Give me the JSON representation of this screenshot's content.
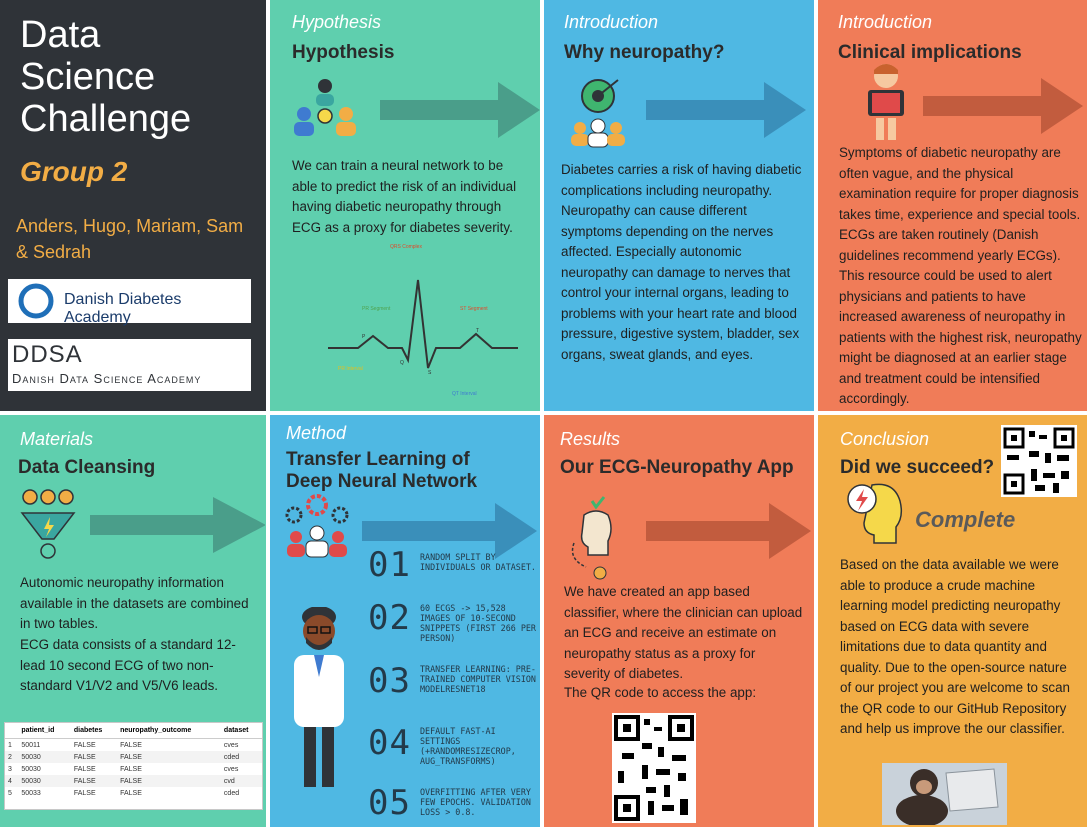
{
  "title_panel": {
    "title_lines": [
      "Data",
      "Science",
      "Challenge"
    ],
    "group": "Group 2",
    "members": "Anders, Hugo, Mariam, Sam & Sedrah",
    "logo1_text": "Danish Diabetes Academy",
    "logo2_abbr": "DDSA",
    "logo2_text": "Danish Data Science Academy"
  },
  "hypothesis": {
    "category": "Hypothesis",
    "heading": "Hypothesis",
    "body": "We can train a neural network to be able to predict the risk of an individual having diabetic neuropathy through ECG as a proxy for diabetes severity.",
    "ecg_labels": {
      "qrs": "QRS Complex",
      "pr": "PR Segment",
      "st": "ST Segment",
      "p": "P",
      "t": "T",
      "q": "Q",
      "s": "S",
      "pr_int": "PR Interval",
      "qt": "QT Interval"
    }
  },
  "intro1": {
    "category": "Introduction",
    "heading": "Why neuropathy?",
    "body": "Diabetes carries a risk of having diabetic complications including neuropathy. Neuropathy can cause different symptoms depending on the nerves affected. Especially autonomic neuropathy can damage to nerves that control your internal organs, leading to problems with your heart rate and blood pressure, digestive system, bladder, sex organs, sweat glands, and eyes."
  },
  "intro2": {
    "category": "Introduction",
    "heading": "Clinical implications",
    "body": "Symptoms of diabetic neuropathy are often vague, and the physical examination require for proper diagnosis takes time, experience and special tools. ECGs are taken routinely (Danish guidelines recommend yearly ECGs). This resource could be used to alert physicians and patients to have increased awareness of neuropathy in patients with the highest risk, neuropathy might be diagnosed at an earlier stage and treatment could be intensified accordingly."
  },
  "materials": {
    "category": "Materials",
    "heading": "Data Cleansing",
    "body1": "Autonomic neuropathy information available in the datasets are combined in two tables.",
    "body2": "ECG data consists of a standard 12-lead 10 second ECG of two non-standard V1/V2 and V5/V6 leads.",
    "table": {
      "columns": [
        "",
        "patient_id",
        "diabetes",
        "neuropathy_outcome",
        "dataset"
      ],
      "rows": [
        [
          "1",
          "50011",
          "FALSE",
          "FALSE",
          "cves"
        ],
        [
          "2",
          "50030",
          "FALSE",
          "FALSE",
          "cded"
        ],
        [
          "3",
          "50030",
          "FALSE",
          "FALSE",
          "cves"
        ],
        [
          "4",
          "50030",
          "FALSE",
          "FALSE",
          "cvd"
        ],
        [
          "5",
          "50033",
          "FALSE",
          "FALSE",
          "cded"
        ]
      ]
    }
  },
  "method": {
    "category": "Method",
    "heading": "Transfer Learning of Deep Neural Network",
    "steps": [
      {
        "num": "01",
        "text": "Random split by individuals or dataset."
      },
      {
        "num": "02",
        "text": "60 ECGs -> 15,528 images of 10-second snippets (first 266 per person)"
      },
      {
        "num": "03",
        "text": "Transfer learning: Pre-trained computer vision modelResNet18"
      },
      {
        "num": "04",
        "text": "Default fast-ai settings (+RandomResizeCrop, aug_transforms)"
      },
      {
        "num": "05",
        "text": "Overfitting after very few epochs. Validation loss > 0.8."
      }
    ]
  },
  "results": {
    "category": "Results",
    "heading": "Our ECG-Neuropathy App",
    "body": "We have created an app based classifier, where the clinician can upload an ECG and receive an estimate on neuropathy status as a proxy for severity of diabetes.",
    "qr_label": "The QR code to access the app:"
  },
  "conclusion": {
    "category": "Conclusion",
    "heading": "Did we succeed?",
    "complete": "Complete",
    "body": "Based on the data available we were able to produce a crude machine learning model predicting neuropathy based on ECG data with severe limitations due to data quantity and quality. Due to the open-source nature of our project you are welcome to scan the QR code to our GitHub Repository and help us improve the our classifier."
  },
  "colors": {
    "dark": "#2f3338",
    "teal": "#5fcfae",
    "blue": "#4fb8e3",
    "coral": "#f07c58",
    "orange": "#f2ad45"
  },
  "icons": [
    "people-lightbulb-icon",
    "target-people-icon",
    "body-xray-icon",
    "lightbulb-funnel-icon",
    "gears-people-icon",
    "doctor-icon",
    "head-check-icon",
    "head-lightning-icon",
    "qr-code-icon"
  ]
}
